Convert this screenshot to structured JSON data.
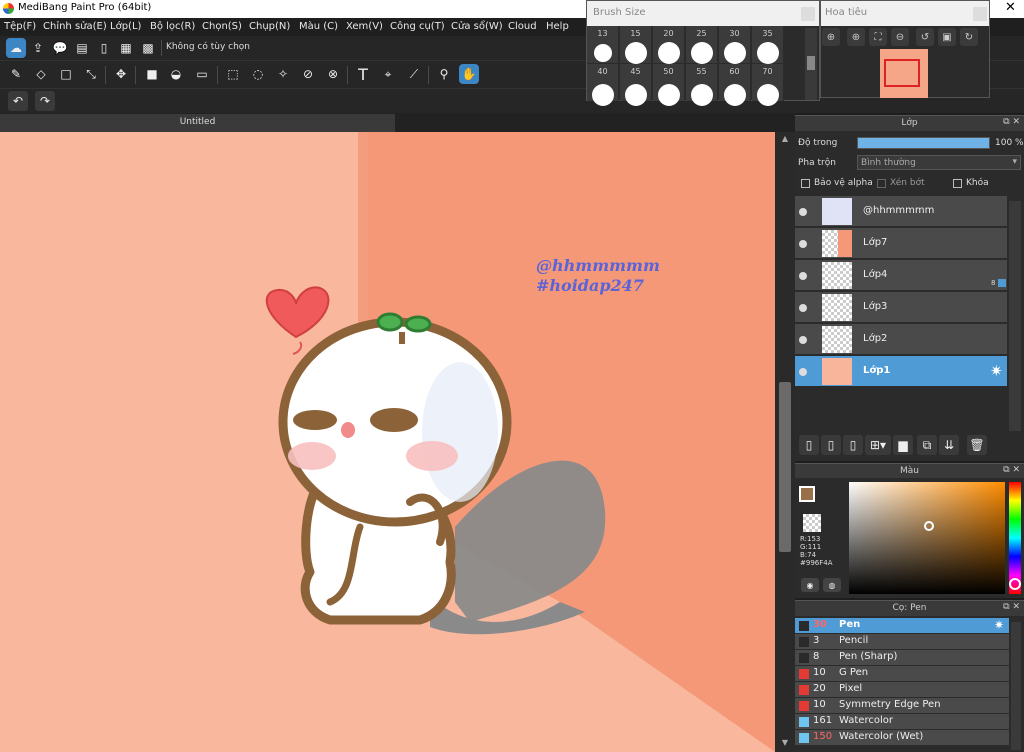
{
  "app": {
    "title": "MediBang Paint Pro (64bit)"
  },
  "menu": [
    "Tệp(F)",
    "Chỉnh sửa(E)",
    "Lớp(L)",
    "Bộ lọc(R)",
    "Chọn(S)",
    "Chụp(N)",
    "Màu (C)",
    "Xem(V)",
    "Công cụ(T)",
    "Cửa sổ(W)",
    "Cloud",
    "Help"
  ],
  "toolbar": {
    "selection_status": "Không có tùy chọn"
  },
  "brush_size_window": {
    "title": "Brush Size",
    "row1": [
      "13",
      "15",
      "20",
      "25",
      "30",
      "35"
    ],
    "row2": [
      "40",
      "45",
      "50",
      "55",
      "60",
      "70"
    ]
  },
  "navigator_window": {
    "title": "Hoa tiêu"
  },
  "canvas": {
    "tab_title": "Untitled",
    "watermark_line1": "@hhmmmmm",
    "watermark_line2": "#hoidap247"
  },
  "layers_panel": {
    "title": "Lớp",
    "opacity_label": "Độ trong",
    "opacity_value": "100 %",
    "opacity_fraction": 1.0,
    "blend_label": "Pha trộn",
    "blend_value": "Bình thường",
    "protect_alpha": "Bảo vệ alpha",
    "clipping": "Xén bớt",
    "lock": "Khóa",
    "layers": [
      {
        "name": "@hhmmmmm",
        "selected": false
      },
      {
        "name": "Lớp7",
        "selected": false
      },
      {
        "name": "Lớp4",
        "selected": false,
        "badge": "8"
      },
      {
        "name": "Lớp3",
        "selected": false
      },
      {
        "name": "Lớp2",
        "selected": false
      },
      {
        "name": "Lớp1",
        "selected": true
      }
    ]
  },
  "color_panel": {
    "title": "Màu",
    "r": "R:153",
    "g": "G:111",
    "b": "B:74",
    "hex": "#996F4A",
    "foreground": "#996F4A"
  },
  "brush_panel": {
    "title": "Cọ: Pen",
    "brushes": [
      {
        "size": "30",
        "name": "Pen",
        "color": "#2a2a2a",
        "selected": true
      },
      {
        "size": "3",
        "name": "Pencil",
        "color": "#2a2a2a",
        "selected": false
      },
      {
        "size": "8",
        "name": "Pen (Sharp)",
        "color": "#2a2a2a",
        "selected": false
      },
      {
        "size": "10",
        "name": "G Pen",
        "color": "#e53935",
        "selected": false
      },
      {
        "size": "20",
        "name": "Pixel",
        "color": "#e53935",
        "selected": false
      },
      {
        "size": "10",
        "name": "Symmetry Edge Pen",
        "color": "#e53935",
        "selected": false
      },
      {
        "size": "161",
        "name": "Watercolor",
        "color": "#6ec6f0",
        "selected": false
      },
      {
        "size": "150",
        "name": "Watercolor (Wet)",
        "color": "#6ec6f0",
        "selected": false
      }
    ]
  },
  "colors": {
    "accent": "#4e9bd6",
    "canvas_bg": "#f6a688",
    "wall": "#f59877"
  }
}
